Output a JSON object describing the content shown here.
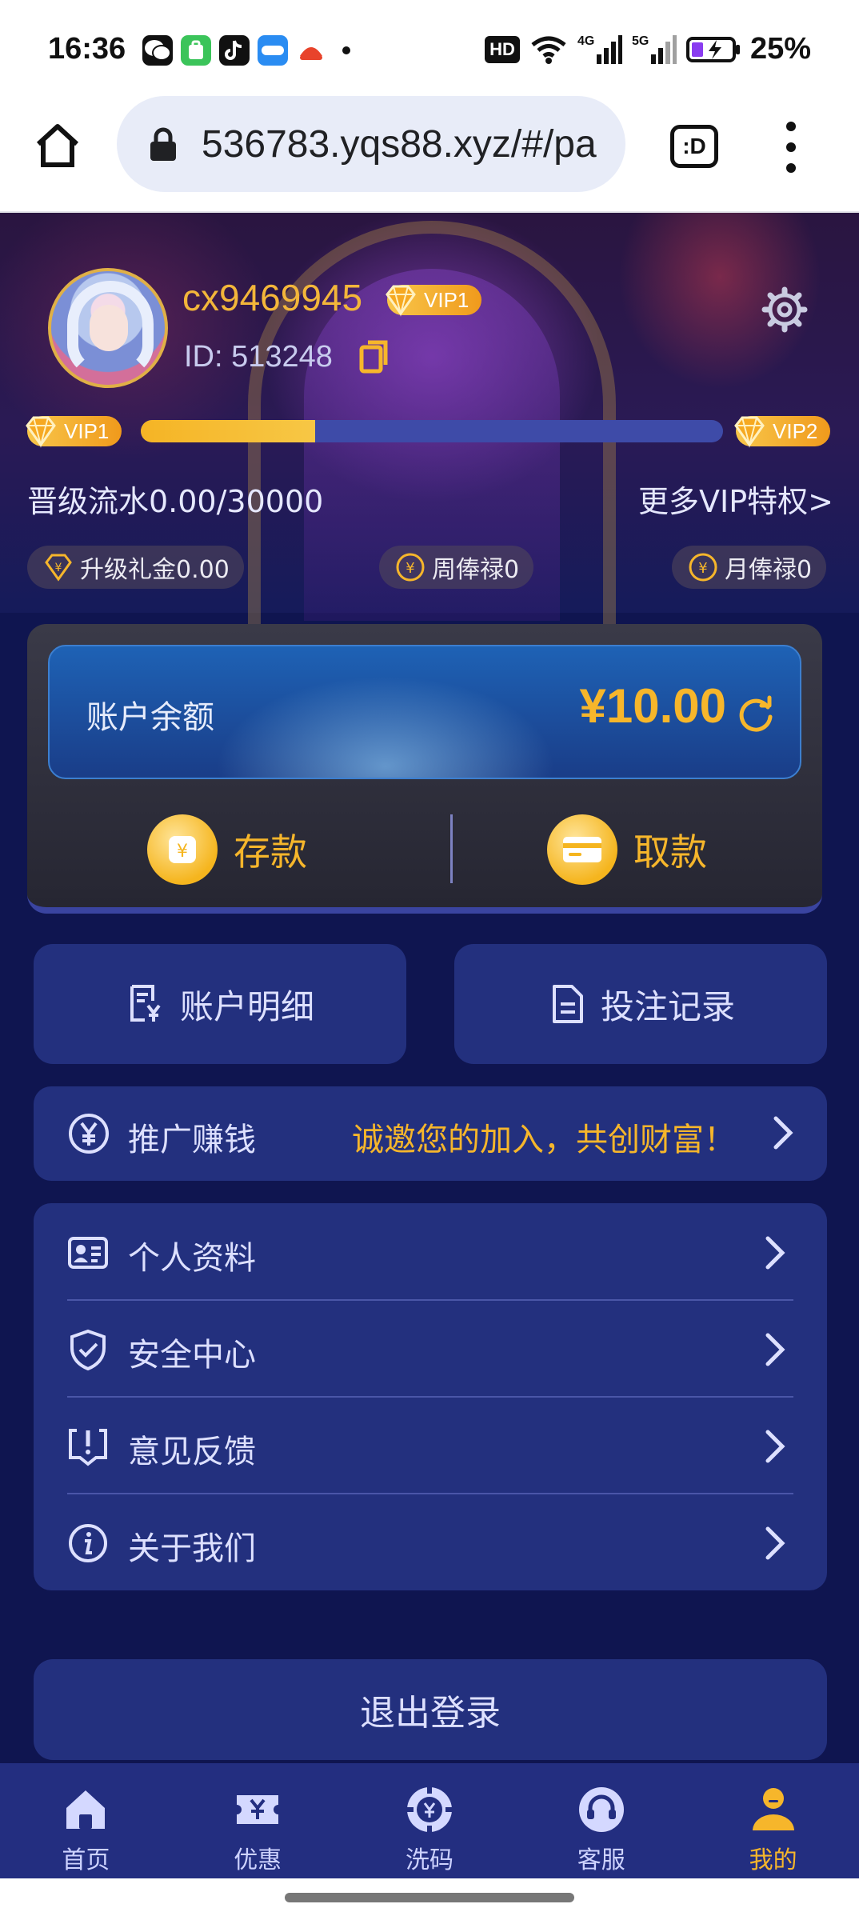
{
  "status_bar": {
    "time": "16:36",
    "hd": "HD",
    "network_4g": "4G",
    "network_5g": "5G",
    "battery": "25%"
  },
  "browser": {
    "url": "536783.yqs88.xyz/#/pa",
    "tabs_label": ":D"
  },
  "profile": {
    "username": "cx9469945",
    "vip_level": "VIP1",
    "id_text": "ID:  513248",
    "current_vip": "VIP1",
    "next_vip": "VIP2",
    "progress_fraction": 0.0,
    "progress_shown_fraction": 0.3,
    "turnover": "晋级流水0.00/30000",
    "more_vip": "更多VIP特权>",
    "perks": [
      {
        "label": "升级礼金0.00"
      },
      {
        "label": "周俸禄0"
      },
      {
        "label": "月俸禄0"
      }
    ]
  },
  "wallet": {
    "balance_label": "账户余额",
    "balance_value": "¥10.00",
    "deposit_label": "存款",
    "withdraw_label": "取款"
  },
  "tiles": {
    "account_details": "账户明细",
    "bet_records": "投注记录"
  },
  "promo": {
    "label": "推广赚钱",
    "slogan": "诚邀您的加入，共创财富！"
  },
  "menu": {
    "items": [
      {
        "label": "个人资料",
        "icon": "id-card-icon"
      },
      {
        "label": "安全中心",
        "icon": "shield-icon"
      },
      {
        "label": "意见反馈",
        "icon": "feedback-icon"
      },
      {
        "label": "关于我们",
        "icon": "info-icon"
      }
    ]
  },
  "logout_label": "退出登录",
  "bottom_nav": {
    "items": [
      {
        "label": "首页",
        "icon": "home-icon"
      },
      {
        "label": "优惠",
        "icon": "coupon-icon"
      },
      {
        "label": "洗码",
        "icon": "chip-icon"
      },
      {
        "label": "客服",
        "icon": "headset-icon"
      },
      {
        "label": "我的",
        "icon": "profile-icon"
      }
    ],
    "active_index": 4
  },
  "colors": {
    "accent_gold": "#f6b62b",
    "card_bg": "#23307e",
    "page_bg": "#0f1550"
  }
}
